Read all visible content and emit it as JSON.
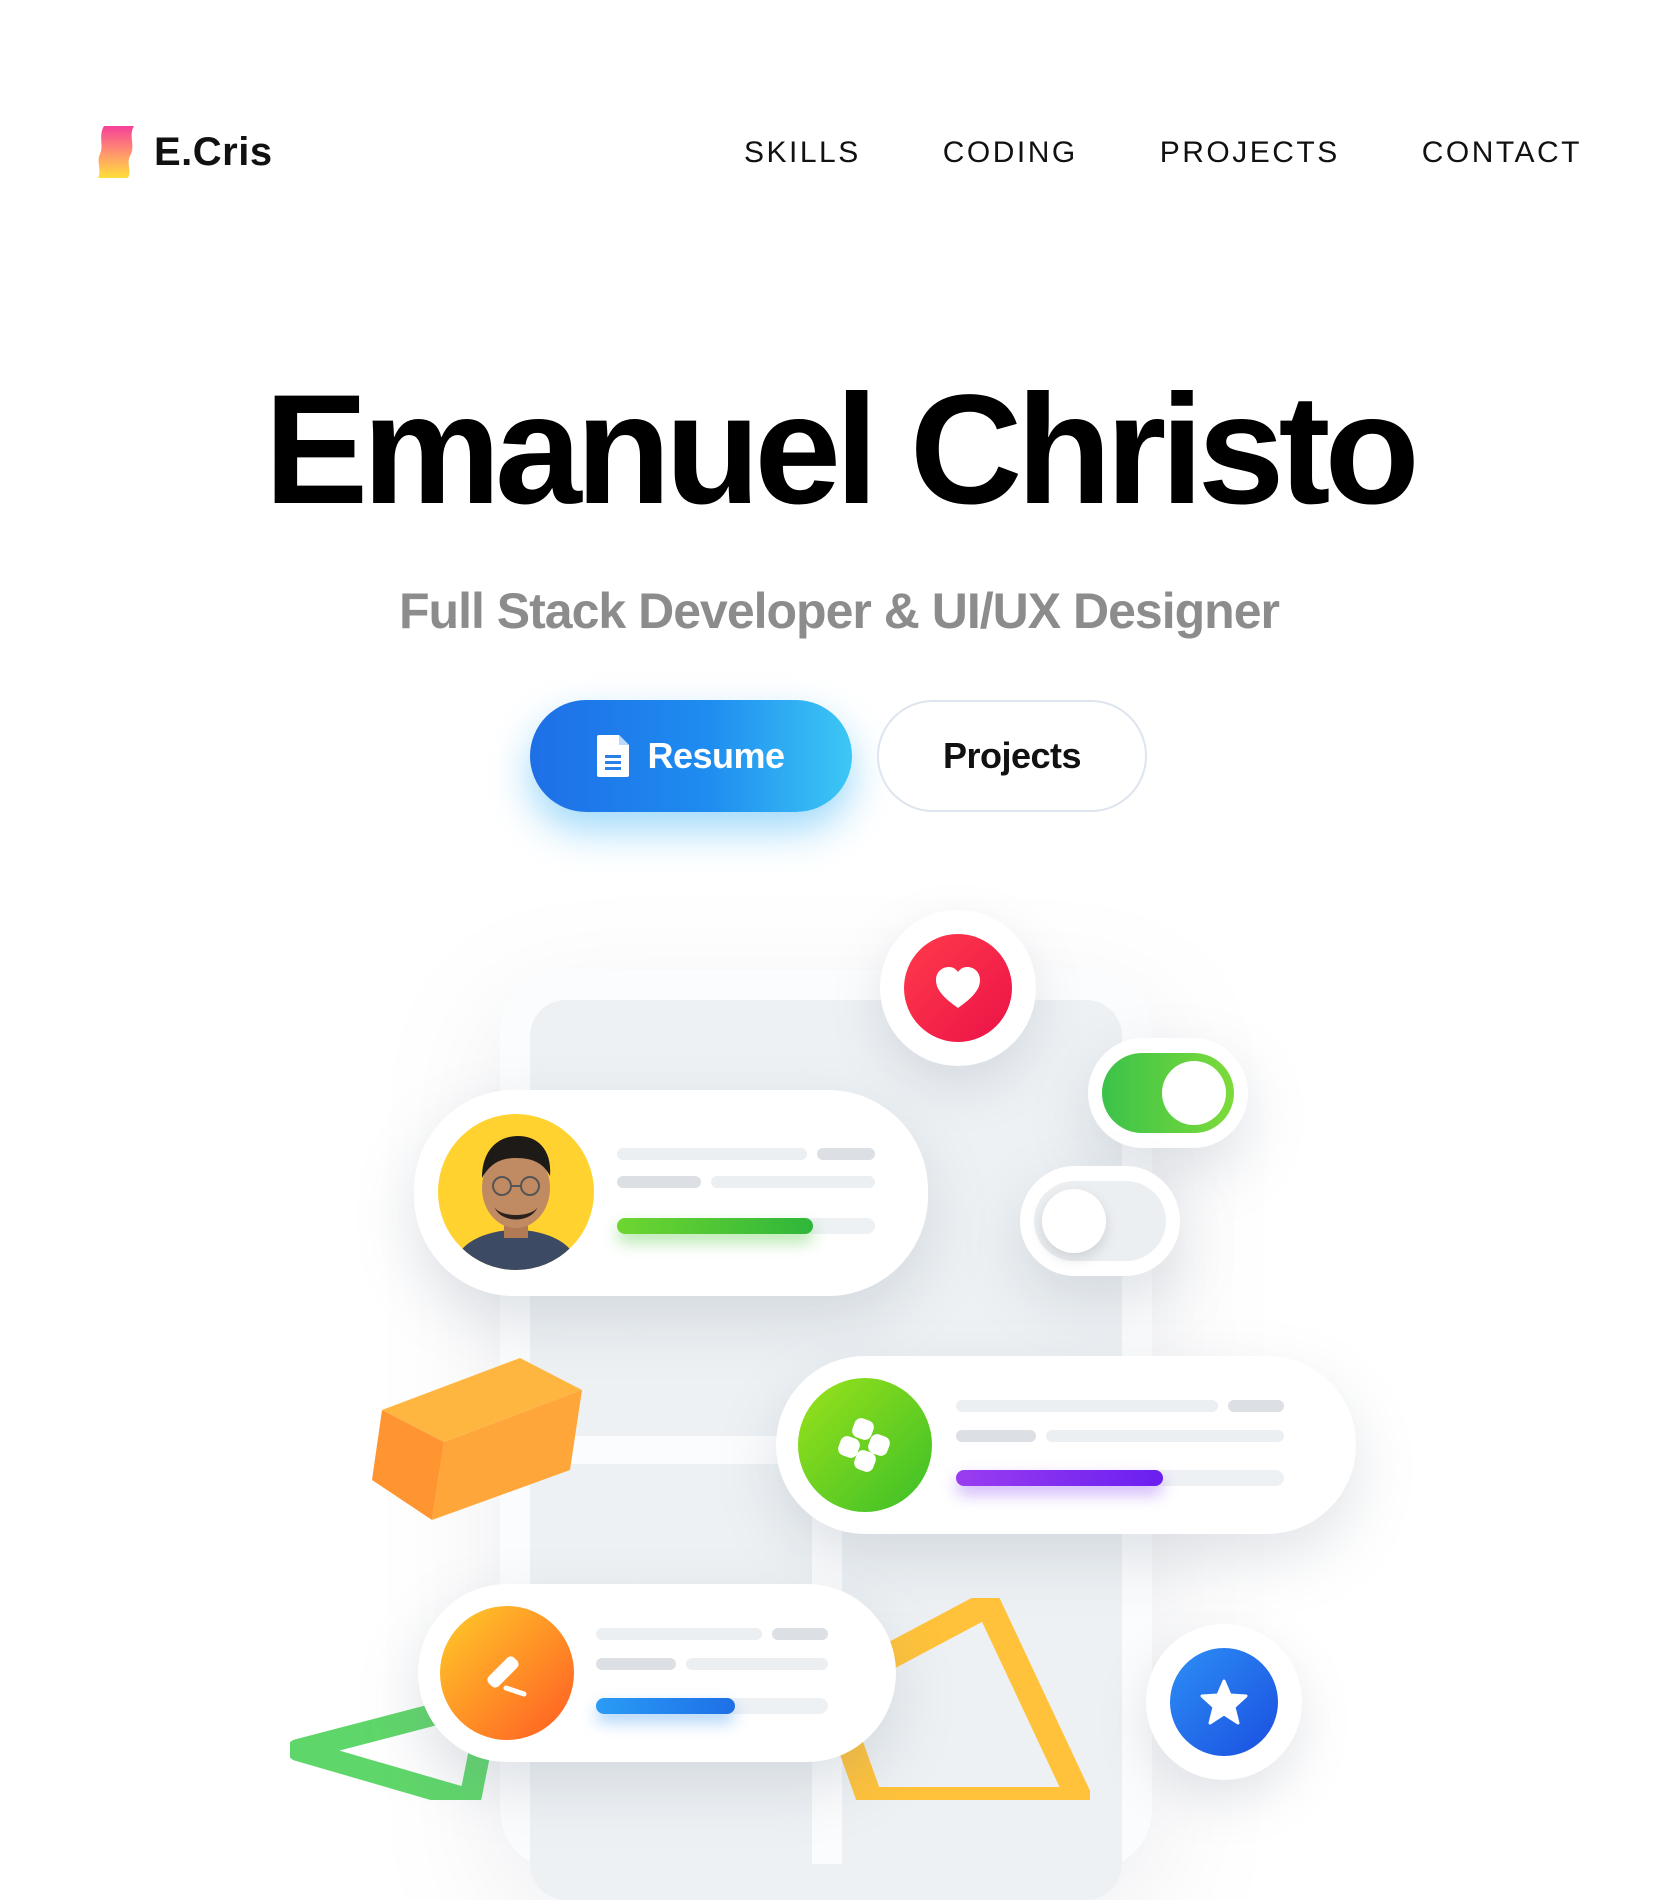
{
  "header": {
    "logo_text": "E.Cris",
    "nav": [
      {
        "label": "SKILLS"
      },
      {
        "label": "CODING"
      },
      {
        "label": "PROJECTS"
      },
      {
        "label": "CONTACT"
      }
    ]
  },
  "hero": {
    "name": "Emanuel Christo",
    "subtitle": "Full Stack Developer & UI/UX Designer",
    "resume_label": "Resume",
    "projects_label": "Projects"
  },
  "colors": {
    "accent_blue": "#1e7fe8",
    "heart_red": "#f0203f",
    "toggle_green": "#4cc53f",
    "lime": "#7ad91e",
    "purple": "#8b3cf0",
    "orange": "#ff9b2e",
    "star_blue": "#1f6fec"
  },
  "illustration": {
    "icons": [
      "heart-icon",
      "toggle-on",
      "toggle-off",
      "apps-grid-icon",
      "pencil-icon",
      "star-icon"
    ],
    "progress": {
      "profile_card": 0.76,
      "apps_card": 0.63,
      "pencil_card": 0.6
    }
  }
}
